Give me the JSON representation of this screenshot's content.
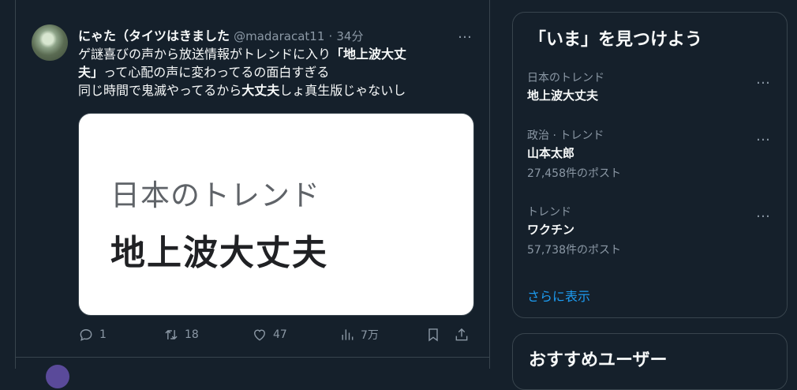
{
  "tweet": {
    "display_name": "にゃた（タイツはきました",
    "handle": "@madaracat11",
    "time": "34分",
    "more_icon": "…",
    "text": {
      "line1_a": "ゲ謎喜びの声から放送情報がトレンドに入り",
      "line1_b": "「地上波大丈",
      "line2_a": "夫」",
      "line2_b": "って心配の声に変わってるの面白すぎる",
      "line3_a": "同じ時間で鬼滅やってるから",
      "line3_b": "大丈夫",
      "line3_c": "しょ真生版じゃないし"
    },
    "image": {
      "subtitle": "日本のトレンド",
      "headline": "地上波大丈夫"
    },
    "actions": {
      "reply_count": "1",
      "retweet_count": "18",
      "like_count": "47",
      "view_count": "7万"
    }
  },
  "trends_panel": {
    "title": "「いま」を見つけよう",
    "items": [
      {
        "context": "日本のトレンド",
        "topic": "地上波大丈夫",
        "count": ""
      },
      {
        "context": "政治 · トレンド",
        "topic": "山本太郎",
        "count": "27,458件のポスト"
      },
      {
        "context": "トレンド",
        "topic": "ワクチン",
        "count": "57,738件のポスト"
      }
    ],
    "show_more": "さらに表示",
    "more_icon": "…"
  },
  "follow_panel": {
    "title": "おすすめユーザー"
  },
  "colors": {
    "background": "#15202b",
    "border": "#38444d",
    "text_primary": "#f7f9f9",
    "text_secondary": "#8b98a5",
    "accent": "#1d9bf0"
  }
}
